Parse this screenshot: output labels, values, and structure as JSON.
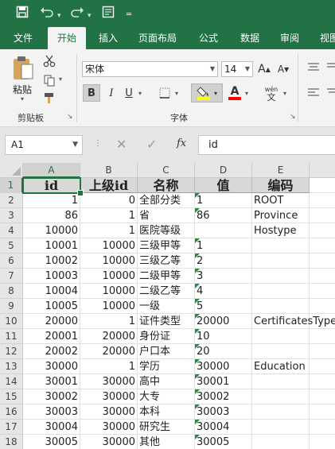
{
  "qat": {
    "save_icon": "save-icon",
    "undo_icon": "undo-icon",
    "redo_icon": "redo-icon",
    "form_icon": "form-icon",
    "customize_icon": "customize-icon"
  },
  "tabs": [
    {
      "label": "文件"
    },
    {
      "label": "开始",
      "active": true
    },
    {
      "label": "插入"
    },
    {
      "label": "页面布局"
    },
    {
      "label": "公式"
    },
    {
      "label": "数据"
    },
    {
      "label": "审阅"
    },
    {
      "label": "视图"
    }
  ],
  "ribbon": {
    "clipboard": {
      "paste_label": "粘贴",
      "group_label": "剪贴板"
    },
    "font": {
      "group_label": "字体",
      "font_name": "宋体",
      "font_size": "14",
      "bold": "B",
      "italic": "I",
      "underline": "U",
      "increase_font": "A",
      "decrease_font": "A",
      "phonetic_top": "wén",
      "phonetic_bottom": "文",
      "fill_color": "#FFFF00",
      "font_color": "#FF0000"
    }
  },
  "formula_bar": {
    "name_box": "A1",
    "fx": "fx",
    "formula": "id"
  },
  "columns": [
    "A",
    "B",
    "C",
    "D",
    "E"
  ],
  "header_row": [
    "id",
    "上级id",
    "名称",
    "值",
    "编码"
  ],
  "rows": [
    {
      "n": "1"
    },
    {
      "n": "2",
      "a": "1",
      "b": "0",
      "c": "全部分类",
      "d": "1",
      "e": "ROOT"
    },
    {
      "n": "3",
      "a": "86",
      "b": "1",
      "c": "省",
      "d": "86",
      "e": "Province"
    },
    {
      "n": "4",
      "a": "10000",
      "b": "1",
      "c": "医院等级",
      "d": "",
      "e": "Hostype"
    },
    {
      "n": "5",
      "a": "10001",
      "b": "10000",
      "c": "三级甲等",
      "d": "1",
      "e": ""
    },
    {
      "n": "6",
      "a": "10002",
      "b": "10000",
      "c": "三级乙等",
      "d": "2",
      "e": ""
    },
    {
      "n": "7",
      "a": "10003",
      "b": "10000",
      "c": "二级甲等",
      "d": "3",
      "e": ""
    },
    {
      "n": "8",
      "a": "10004",
      "b": "10000",
      "c": "二级乙等",
      "d": "4",
      "e": ""
    },
    {
      "n": "9",
      "a": "10005",
      "b": "10000",
      "c": "一级",
      "d": "5",
      "e": ""
    },
    {
      "n": "10",
      "a": "20000",
      "b": "1",
      "c": "证件类型",
      "d": "20000",
      "e": "CertificatesType"
    },
    {
      "n": "11",
      "a": "20001",
      "b": "20000",
      "c": "身份证",
      "d": "10",
      "e": ""
    },
    {
      "n": "12",
      "a": "20002",
      "b": "20000",
      "c": "户口本",
      "d": "20",
      "e": ""
    },
    {
      "n": "13",
      "a": "30000",
      "b": "1",
      "c": "学历",
      "d": "30000",
      "e": "Education"
    },
    {
      "n": "14",
      "a": "30001",
      "b": "30000",
      "c": "高中",
      "d": "30001",
      "e": ""
    },
    {
      "n": "15",
      "a": "30002",
      "b": "30000",
      "c": "大专",
      "d": "30002",
      "e": ""
    },
    {
      "n": "16",
      "a": "30003",
      "b": "30000",
      "c": "本科",
      "d": "30003",
      "e": ""
    },
    {
      "n": "17",
      "a": "30004",
      "b": "30000",
      "c": "研究生",
      "d": "30004",
      "e": ""
    },
    {
      "n": "18",
      "a": "30005",
      "b": "30000",
      "c": "其他",
      "d": "30005",
      "e": ""
    }
  ],
  "colors": {
    "brand": "#217346",
    "text_marker": "#1e8f3e"
  }
}
